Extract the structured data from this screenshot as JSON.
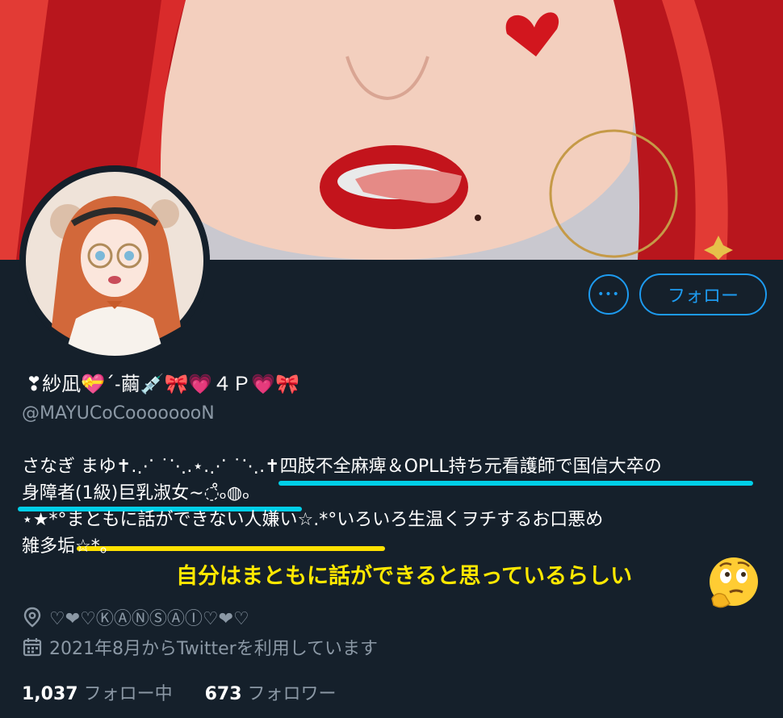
{
  "profile": {
    "display_name": "❣紗凪💝ˊ˗繭💉🎀💗４Ｐ💗🎀",
    "handle": "@MAYUCoCoooooooN",
    "bio_lines": [
      "さなぎ まゆ✝.⋰ ˙⋱.⋆.⋰ ˙⋱.✝四肢不全麻痺＆OPLL持ち元看護師で国信大卒の",
      "身障者(1級)巨乳淑女∼◌̊ₒ◍ₒ",
      "⋆★*°まともに話ができない人嫌い☆.*°いろいろ生温くヲチするお口悪め",
      "雑多垢☆*。"
    ],
    "location": "♡❤♡ⓀⒶⓃⓈⒶⒾ♡❤♡",
    "joined": "2021年8月からTwitterを利用しています",
    "following_count": "1,037",
    "following_label": "フォロー中",
    "followers_count": "673",
    "followers_label": "フォロワー"
  },
  "buttons": {
    "more_label": "•••",
    "follow_label": "フォロー"
  },
  "annotation": {
    "text": "自分はまともに話ができると思っているらしい"
  },
  "icons": {
    "location": "location-pin-icon",
    "calendar": "calendar-icon",
    "more": "more-dots-icon",
    "thinking": "thinking-face-icon"
  },
  "colors": {
    "background": "#15202b",
    "accent": "#1d9bf0",
    "muted_text": "#8b98a5",
    "highlight_cyan": "#00cfe8",
    "highlight_yellow": "#ffe100",
    "annotation_text": "#ffe800"
  }
}
